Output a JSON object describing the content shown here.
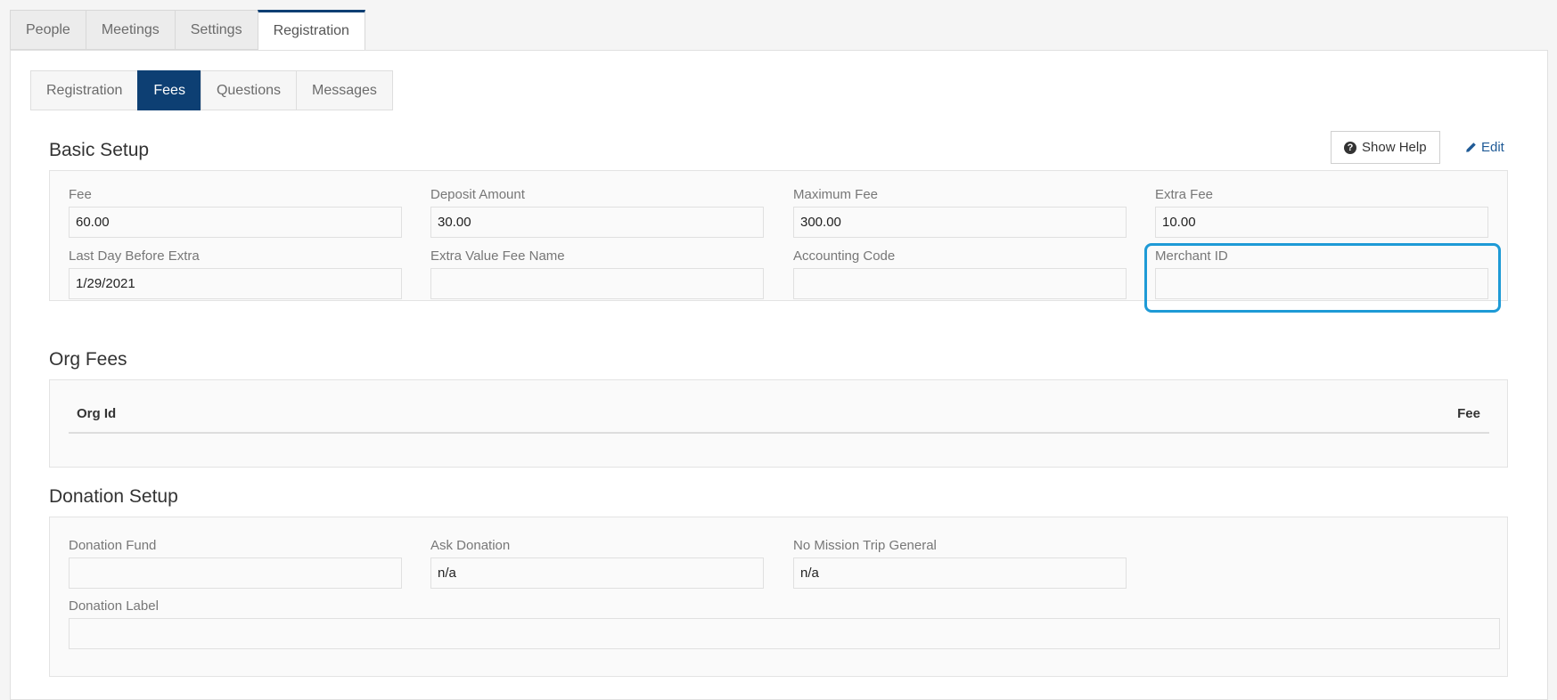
{
  "top_tabs": [
    {
      "label": "People"
    },
    {
      "label": "Meetings"
    },
    {
      "label": "Settings"
    },
    {
      "label": "Registration"
    }
  ],
  "sub_tabs": [
    {
      "label": "Registration"
    },
    {
      "label": "Fees"
    },
    {
      "label": "Questions"
    },
    {
      "label": "Messages"
    }
  ],
  "actions": {
    "show_help": "Show Help",
    "edit": "Edit"
  },
  "basic_setup": {
    "title": "Basic Setup",
    "fee": {
      "label": "Fee",
      "value": "60.00"
    },
    "deposit_amount": {
      "label": "Deposit Amount",
      "value": "30.00"
    },
    "maximum_fee": {
      "label": "Maximum Fee",
      "value": "300.00"
    },
    "extra_fee": {
      "label": "Extra Fee",
      "value": "10.00"
    },
    "last_day_before_extra": {
      "label": "Last Day Before Extra",
      "value": "1/29/2021"
    },
    "extra_value_fee_name": {
      "label": "Extra Value Fee Name",
      "value": ""
    },
    "accounting_code": {
      "label": "Accounting Code",
      "value": ""
    },
    "merchant_id": {
      "label": "Merchant ID",
      "value": ""
    }
  },
  "org_fees": {
    "title": "Org Fees",
    "columns": [
      "Org Id",
      "Fee"
    ]
  },
  "donation_setup": {
    "title": "Donation Setup",
    "donation_fund": {
      "label": "Donation Fund",
      "value": ""
    },
    "ask_donation": {
      "label": "Ask Donation",
      "value": "n/a"
    },
    "no_mission_trip_general": {
      "label": "No Mission Trip General",
      "value": "n/a"
    },
    "donation_label": {
      "label": "Donation Label",
      "value": ""
    }
  },
  "colors": {
    "active_tab": "#0d3f73",
    "highlight": "#1e9ad6",
    "link": "#1f5a96"
  }
}
